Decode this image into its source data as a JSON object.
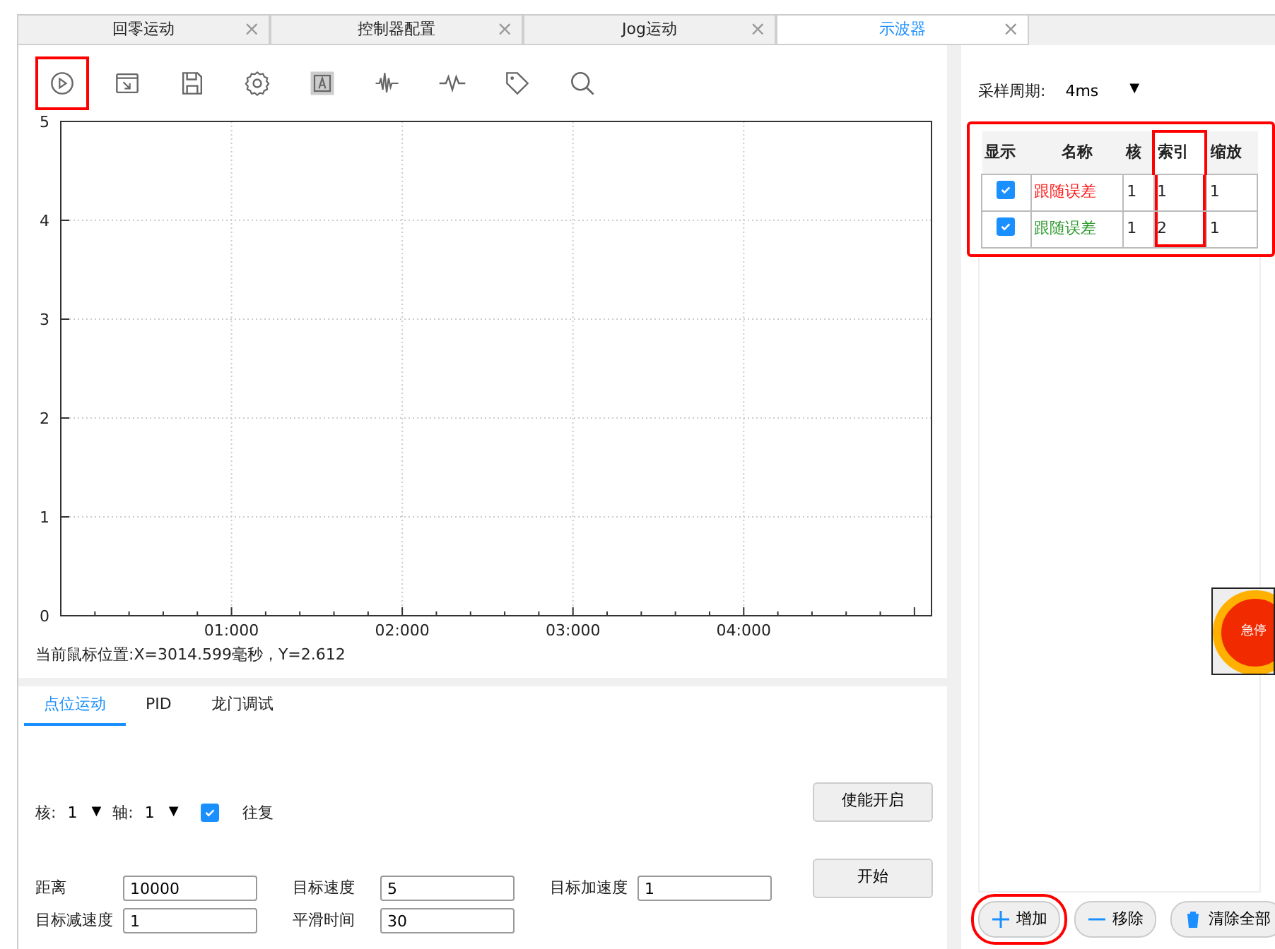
{
  "tabs": [
    {
      "label": "回零运动",
      "close": "×",
      "selected": false
    },
    {
      "label": "控制器配置",
      "close": "×",
      "selected": false
    },
    {
      "label": "Jog运动",
      "close": "×",
      "selected": false
    },
    {
      "label": "示波器",
      "close": "×",
      "selected": true
    }
  ],
  "toolbar": [
    {
      "kind": "play",
      "highlighted": true
    },
    {
      "kind": "open",
      "highlighted": false
    },
    {
      "kind": "save",
      "highlighted": false
    },
    {
      "kind": "settings",
      "highlighted": false
    },
    {
      "kind": "auto",
      "highlighted": false
    },
    {
      "kind": "wave",
      "highlighted": false
    },
    {
      "kind": "pulse",
      "highlighted": false
    },
    {
      "kind": "tag",
      "highlighted": false
    },
    {
      "kind": "search",
      "highlighted": false
    }
  ],
  "chart": {
    "chart_data": {
      "type": "line",
      "grid": true,
      "categories": [
        null,
        "01:000",
        "02:000",
        "03:000",
        "04:000",
        null
      ],
      "ylim": [
        0,
        5
      ],
      "yticks": [
        0,
        1,
        2,
        3,
        4,
        5
      ]
    }
  },
  "cursor_position": "当前鼠标位置:X=3014.599毫秒，Y=2.612",
  "bottom_tabs": [
    {
      "label": "点位运动",
      "selected": true
    },
    {
      "label": "PID",
      "selected": false
    },
    {
      "label": "龙门调试",
      "selected": false
    }
  ],
  "selectors": [
    {
      "label": "核:",
      "value": "1",
      "caret": "▼"
    },
    {
      "label": "轴:",
      "value": "1",
      "caret": "▼"
    }
  ],
  "reciprocate": {
    "label": "往复",
    "checked": true
  },
  "fields": [
    {
      "label": "距离",
      "value": "10000"
    },
    {
      "label": "目标速度",
      "value": "5"
    },
    {
      "label": "目标加速度",
      "value": "1"
    },
    {
      "label": "目标减速度",
      "value": "1"
    },
    {
      "label": "平滑时间",
      "value": "30"
    }
  ],
  "action_buttons": [
    "使能开启",
    "开始"
  ],
  "sample_period": {
    "label": "采样周期:",
    "value": "4ms",
    "caret": "▼"
  },
  "channel_table": {
    "highlighted": true,
    "columns": [
      {
        "label": "显示",
        "highlighted": false
      },
      {
        "label": "名称",
        "highlighted": false
      },
      {
        "label": "核",
        "highlighted": false
      },
      {
        "label": "索引",
        "highlighted": true
      },
      {
        "label": "缩放",
        "highlighted": false
      }
    ],
    "rows": [
      {
        "checked": true,
        "name": "跟随误差",
        "color": "#ff2020",
        "core": "1",
        "index": "1",
        "scale": "1"
      },
      {
        "checked": true,
        "name": "跟随误差",
        "color": "#2e9a2e",
        "core": "1",
        "index": "2",
        "scale": "1"
      }
    ]
  },
  "list_buttons": [
    {
      "kind": "add",
      "label": "增加",
      "highlighted": true
    },
    {
      "kind": "remove",
      "label": "移除",
      "highlighted": false
    },
    {
      "kind": "clear",
      "label": "清除全部",
      "highlighted": false
    }
  ],
  "emergency_stop": "急停"
}
